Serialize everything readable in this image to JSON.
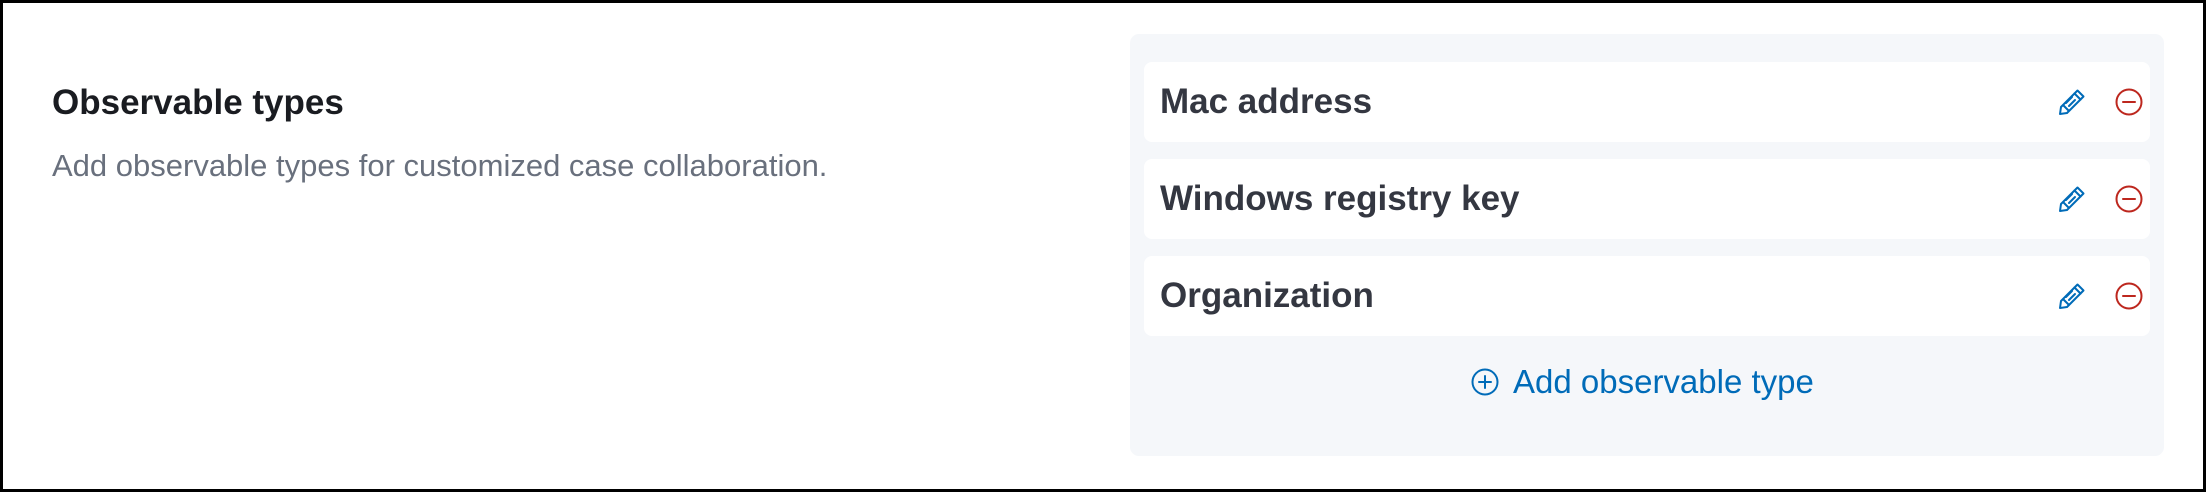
{
  "section": {
    "title": "Observable types",
    "description": "Add observable types for customized case collaboration."
  },
  "observable_types": [
    {
      "label": "Mac address"
    },
    {
      "label": "Windows registry key"
    },
    {
      "label": "Organization"
    }
  ],
  "actions": {
    "add_label": "Add observable type",
    "edit_icon": "pencil-icon",
    "remove_icon": "minus-circle-icon",
    "add_icon": "plus-circle-icon"
  },
  "colors": {
    "primary": "#006bb8",
    "danger": "#bd271e",
    "title_text": "#1a1c21",
    "item_text": "#343741",
    "subdued_text": "#69707d",
    "panel_background": "#f5f7fa"
  }
}
